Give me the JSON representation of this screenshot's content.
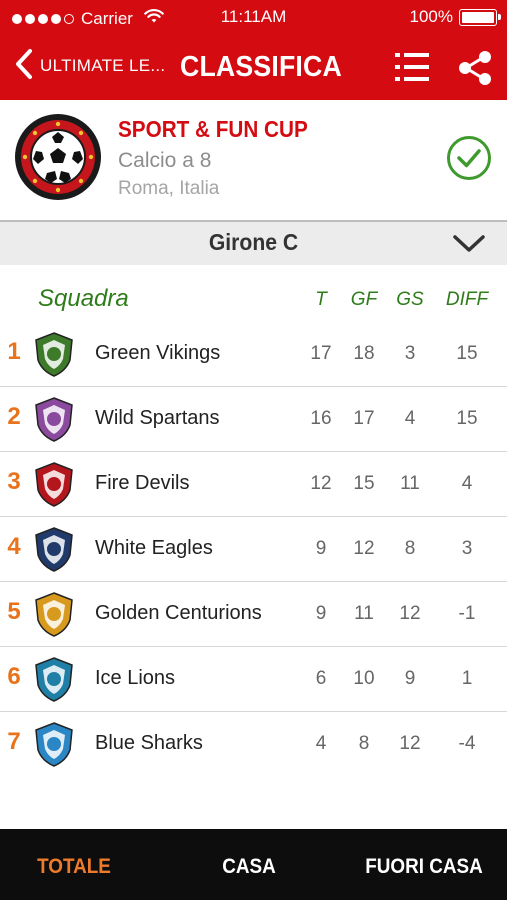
{
  "status_bar": {
    "carrier": "Carrier",
    "time": "11:11AM",
    "battery": "100%",
    "battery_level": 1.0
  },
  "nav": {
    "back_label": "ULTIMATE LE...",
    "title": "CLASSIFICA",
    "icons": [
      "chevron-left-icon",
      "list-icon",
      "share-icon"
    ]
  },
  "tournament": {
    "name": "SPORT & FUN CUP",
    "sport": "Calcio a 8",
    "location": "Roma, Italia",
    "icons": [
      "soccer-ball-logo",
      "checkmark-circle-icon"
    ]
  },
  "group_selector": {
    "label": "Girone C",
    "icon": "chevron-down-icon"
  },
  "table": {
    "headers": {
      "team": "Squadra",
      "t": "T",
      "gf": "GF",
      "gs": "GS",
      "diff": "DIFF"
    },
    "rows": [
      {
        "pos": "1",
        "team": "Green Vikings",
        "t": "17",
        "gf": "18",
        "gs": "3",
        "diff": "15",
        "crest": "viking-crest",
        "color": "#3d7a2a"
      },
      {
        "pos": "2",
        "team": "Wild Spartans",
        "t": "16",
        "gf": "17",
        "gs": "4",
        "diff": "15",
        "crest": "spartan-crest",
        "color": "#8a4a9e"
      },
      {
        "pos": "3",
        "team": "Fire Devils",
        "t": "12",
        "gf": "15",
        "gs": "11",
        "diff": "4",
        "crest": "devil-crest",
        "color": "#b3161c"
      },
      {
        "pos": "4",
        "team": "White Eagles",
        "t": "9",
        "gf": "12",
        "gs": "8",
        "diff": "3",
        "crest": "eagle-crest",
        "color": "#1f3a6b"
      },
      {
        "pos": "5",
        "team": "Golden Centurions",
        "t": "9",
        "gf": "11",
        "gs": "12",
        "diff": "-1",
        "crest": "centurion-crest",
        "color": "#d79a1e"
      },
      {
        "pos": "6",
        "team": "Ice Lions",
        "t": "6",
        "gf": "10",
        "gs": "9",
        "diff": "1",
        "crest": "lion-crest",
        "color": "#1f7fa6"
      },
      {
        "pos": "7",
        "team": "Blue Sharks",
        "t": "4",
        "gf": "8",
        "gs": "12",
        "diff": "-4",
        "crest": "shark-crest",
        "color": "#2a86c4"
      }
    ]
  },
  "tabs": [
    {
      "label": "TOTALE",
      "active": true
    },
    {
      "label": "CASA",
      "active": false
    },
    {
      "label": "FUORI CASA",
      "active": false
    }
  ],
  "colors": {
    "header_red": "#d40b11",
    "rank_orange": "#e8731c",
    "header_green": "#2e7d1a",
    "tab_active": "#ee7a2b",
    "tab_bar": "#0d0d0d"
  }
}
